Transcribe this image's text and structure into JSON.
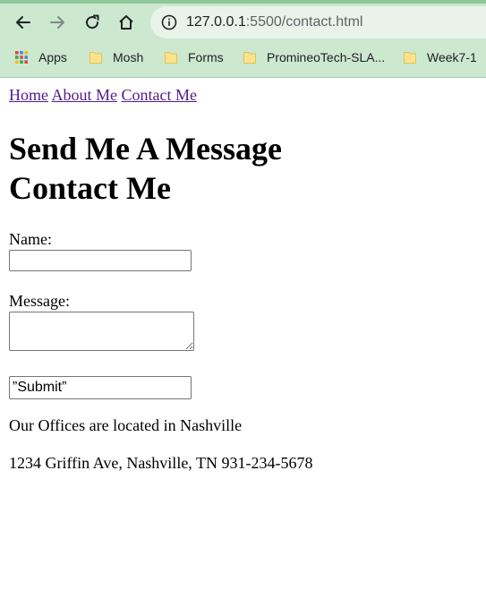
{
  "browser": {
    "url_host": "127.0.0.1",
    "url_rest": ":5500/contact.html",
    "bookmarks": [
      {
        "label": "Apps",
        "icon": "apps-grid-icon"
      },
      {
        "label": "Mosh",
        "icon": "folder-icon"
      },
      {
        "label": "Forms",
        "icon": "folder-icon"
      },
      {
        "label": "PromineoTech-SLA...",
        "icon": "folder-icon"
      },
      {
        "label": "Week7-1",
        "icon": "folder-icon"
      }
    ]
  },
  "nav": {
    "home": "Home",
    "about": "About Me",
    "contact": "Contact Me"
  },
  "heading": {
    "line1": "Send Me A Message",
    "line2": "Contact Me"
  },
  "form": {
    "name_label": "Name:",
    "name_value": "",
    "message_label": "Message:",
    "message_value": "",
    "submit_value": "”Submit”"
  },
  "info": {
    "offices": "Our Offices are located in Nashville",
    "address": "1234 Griffin Ave, Nashville, TN 931-234-5678"
  }
}
